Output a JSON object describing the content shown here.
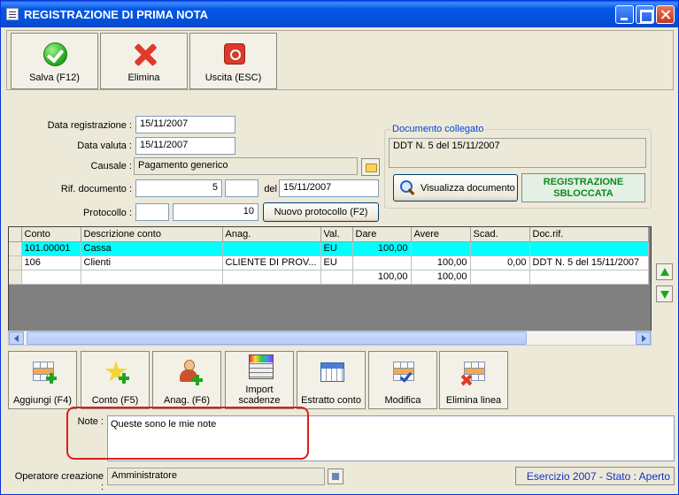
{
  "window": {
    "title": "REGISTRAZIONE DI PRIMA NOTA"
  },
  "toolbar": [
    {
      "label": "Salva (F12)",
      "icon": "checkmark-icon"
    },
    {
      "label": "Elimina",
      "icon": "delete-x-icon"
    },
    {
      "label": "Uscita (ESC)",
      "icon": "power-icon"
    }
  ],
  "form": {
    "data_registrazione_label": "Data registrazione :",
    "data_registrazione": "15/11/2007",
    "data_valuta_label": "Data valuta :",
    "data_valuta": "15/11/2007",
    "causale_label": "Causale :",
    "causale": "Pagamento generico",
    "rif_documento_label": "Rif. documento :",
    "rif_numero": "5",
    "rif_suffisso": "",
    "del_label": "del",
    "rif_data": "15/11/2007",
    "protocollo_label": "Protocollo :",
    "protocollo_serie": "",
    "protocollo_numero": "10",
    "nuovo_protocollo_button": "Nuovo protocollo (F2)"
  },
  "documento_collegato": {
    "title": "Documento collegato",
    "value": "DDT N. 5 del 15/11/2007",
    "visualizza_button": "Visualizza documento",
    "stato_line1": "REGISTRAZIONE",
    "stato_line2": "SBLOCCATA"
  },
  "grid": {
    "columns": [
      "Conto",
      "Descrizione conto",
      "Anag.",
      "Val.",
      "Dare",
      "Avere",
      "Scad.",
      "Doc.rif."
    ],
    "rows": [
      [
        "101.00001",
        "Cassa",
        "",
        "EU",
        "100,00",
        "",
        "",
        ""
      ],
      [
        "106",
        "Clienti",
        "CLIENTE DI PROV...",
        "EU",
        "",
        "100,00",
        "0,00",
        "DDT N. 5 del 15/11/2007"
      ],
      [
        "",
        "",
        "",
        "",
        "100,00",
        "100,00",
        "",
        ""
      ]
    ]
  },
  "bottom_buttons": [
    {
      "label": "Aggiungi (F4)",
      "icon": "grid-add-icon"
    },
    {
      "label": "Conto (F5)",
      "icon": "star-add-icon"
    },
    {
      "label": "Anag. (F6)",
      "icon": "person-add-icon"
    },
    {
      "label_line1": "Import",
      "label_line2": "scadenze",
      "icon": "import-icon"
    },
    {
      "label": "Estratto conto",
      "icon": "calendar-icon"
    },
    {
      "label": "Modifica",
      "icon": "grid-check-icon"
    },
    {
      "label": "Elimina linea",
      "icon": "grid-delete-icon"
    }
  ],
  "note": {
    "label": "Note :",
    "value": "Queste sono le mie note"
  },
  "operatore": {
    "label": "Operatore creazione :",
    "value": "Amministratore"
  },
  "status": "Esercizio 2007 - Stato : Aperto",
  "colors": {
    "selected_row": "#00ffff",
    "status_text": "#1230c8",
    "state_text": "#0a8a1e",
    "annotation": "#e21b1b"
  }
}
